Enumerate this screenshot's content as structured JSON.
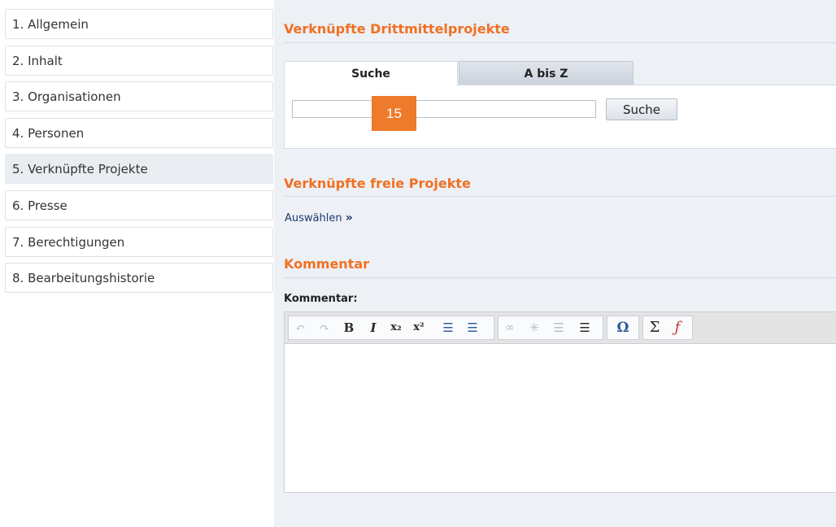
{
  "sidebar": {
    "items": [
      {
        "label": "1. Allgemein"
      },
      {
        "label": "2. Inhalt"
      },
      {
        "label": "3. Organisationen"
      },
      {
        "label": "4. Personen"
      },
      {
        "label": "5. Verknüpfte Projekte",
        "active": true
      },
      {
        "label": "6. Presse"
      },
      {
        "label": "7. Berechtigungen"
      },
      {
        "label": "8. Bearbeitungshistorie"
      }
    ]
  },
  "main": {
    "third_party_section": {
      "title": "Verknüpfte Drittmittelprojekte",
      "tabs": [
        {
          "label": "Suche",
          "active": true
        },
        {
          "label": "A bis Z",
          "active": false
        }
      ],
      "search_value": "",
      "search_button": "Suche",
      "badge": "15"
    },
    "free_section": {
      "title": "Verknüpfte freie Projekte",
      "select_link": "Auswählen",
      "select_arrow": "»"
    },
    "comment_section": {
      "title": "Kommentar",
      "field_label": "Kommentar:",
      "toolbar": [
        {
          "icon": "undo-icon",
          "glyph": "↶"
        },
        {
          "icon": "redo-icon",
          "glyph": "↷"
        },
        {
          "icon": "bold-icon",
          "glyph": "B"
        },
        {
          "icon": "italic-icon",
          "glyph": "I"
        },
        {
          "icon": "subscript-icon",
          "glyph": "x₂"
        },
        {
          "icon": "superscript-icon",
          "glyph": "x²"
        },
        {
          "icon": "numbered-list-icon",
          "glyph": "☰"
        },
        {
          "icon": "bulleted-list-icon",
          "glyph": "☰"
        },
        {
          "icon": "link-icon",
          "glyph": "∞"
        },
        {
          "icon": "unlink-icon",
          "glyph": "✳"
        },
        {
          "icon": "outdent-icon",
          "glyph": "☰"
        },
        {
          "icon": "indent-icon",
          "glyph": "☰"
        },
        {
          "icon": "special-char-icon",
          "glyph": "Ω"
        },
        {
          "icon": "sum-icon",
          "glyph": "Σ"
        },
        {
          "icon": "formula-icon",
          "glyph": "ƒ"
        }
      ],
      "content": ""
    }
  },
  "colors": {
    "accent": "#f07022",
    "badge": "#ee7a2b",
    "main_bg": "#edf0f5",
    "link": "#1e3a6e"
  }
}
